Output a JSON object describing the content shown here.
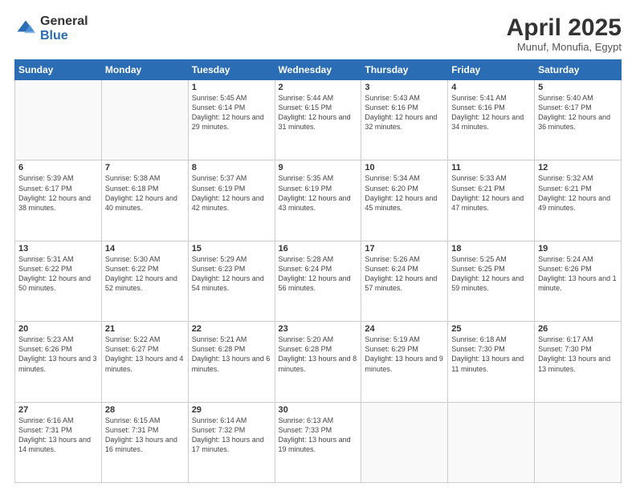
{
  "logo": {
    "general": "General",
    "blue": "Blue"
  },
  "header": {
    "title": "April 2025",
    "subtitle": "Munuf, Monufia, Egypt"
  },
  "weekdays": [
    "Sunday",
    "Monday",
    "Tuesday",
    "Wednesday",
    "Thursday",
    "Friday",
    "Saturday"
  ],
  "weeks": [
    [
      {
        "day": "",
        "info": ""
      },
      {
        "day": "",
        "info": ""
      },
      {
        "day": "1",
        "info": "Sunrise: 5:45 AM\nSunset: 6:14 PM\nDaylight: 12 hours and 29 minutes."
      },
      {
        "day": "2",
        "info": "Sunrise: 5:44 AM\nSunset: 6:15 PM\nDaylight: 12 hours and 31 minutes."
      },
      {
        "day": "3",
        "info": "Sunrise: 5:43 AM\nSunset: 6:16 PM\nDaylight: 12 hours and 32 minutes."
      },
      {
        "day": "4",
        "info": "Sunrise: 5:41 AM\nSunset: 6:16 PM\nDaylight: 12 hours and 34 minutes."
      },
      {
        "day": "5",
        "info": "Sunrise: 5:40 AM\nSunset: 6:17 PM\nDaylight: 12 hours and 36 minutes."
      }
    ],
    [
      {
        "day": "6",
        "info": "Sunrise: 5:39 AM\nSunset: 6:17 PM\nDaylight: 12 hours and 38 minutes."
      },
      {
        "day": "7",
        "info": "Sunrise: 5:38 AM\nSunset: 6:18 PM\nDaylight: 12 hours and 40 minutes."
      },
      {
        "day": "8",
        "info": "Sunrise: 5:37 AM\nSunset: 6:19 PM\nDaylight: 12 hours and 42 minutes."
      },
      {
        "day": "9",
        "info": "Sunrise: 5:35 AM\nSunset: 6:19 PM\nDaylight: 12 hours and 43 minutes."
      },
      {
        "day": "10",
        "info": "Sunrise: 5:34 AM\nSunset: 6:20 PM\nDaylight: 12 hours and 45 minutes."
      },
      {
        "day": "11",
        "info": "Sunrise: 5:33 AM\nSunset: 6:21 PM\nDaylight: 12 hours and 47 minutes."
      },
      {
        "day": "12",
        "info": "Sunrise: 5:32 AM\nSunset: 6:21 PM\nDaylight: 12 hours and 49 minutes."
      }
    ],
    [
      {
        "day": "13",
        "info": "Sunrise: 5:31 AM\nSunset: 6:22 PM\nDaylight: 12 hours and 50 minutes."
      },
      {
        "day": "14",
        "info": "Sunrise: 5:30 AM\nSunset: 6:22 PM\nDaylight: 12 hours and 52 minutes."
      },
      {
        "day": "15",
        "info": "Sunrise: 5:29 AM\nSunset: 6:23 PM\nDaylight: 12 hours and 54 minutes."
      },
      {
        "day": "16",
        "info": "Sunrise: 5:28 AM\nSunset: 6:24 PM\nDaylight: 12 hours and 56 minutes."
      },
      {
        "day": "17",
        "info": "Sunrise: 5:26 AM\nSunset: 6:24 PM\nDaylight: 12 hours and 57 minutes."
      },
      {
        "day": "18",
        "info": "Sunrise: 5:25 AM\nSunset: 6:25 PM\nDaylight: 12 hours and 59 minutes."
      },
      {
        "day": "19",
        "info": "Sunrise: 5:24 AM\nSunset: 6:26 PM\nDaylight: 13 hours and 1 minute."
      }
    ],
    [
      {
        "day": "20",
        "info": "Sunrise: 5:23 AM\nSunset: 6:26 PM\nDaylight: 13 hours and 3 minutes."
      },
      {
        "day": "21",
        "info": "Sunrise: 5:22 AM\nSunset: 6:27 PM\nDaylight: 13 hours and 4 minutes."
      },
      {
        "day": "22",
        "info": "Sunrise: 5:21 AM\nSunset: 6:28 PM\nDaylight: 13 hours and 6 minutes."
      },
      {
        "day": "23",
        "info": "Sunrise: 5:20 AM\nSunset: 6:28 PM\nDaylight: 13 hours and 8 minutes."
      },
      {
        "day": "24",
        "info": "Sunrise: 5:19 AM\nSunset: 6:29 PM\nDaylight: 13 hours and 9 minutes."
      },
      {
        "day": "25",
        "info": "Sunrise: 6:18 AM\nSunset: 7:30 PM\nDaylight: 13 hours and 11 minutes."
      },
      {
        "day": "26",
        "info": "Sunrise: 6:17 AM\nSunset: 7:30 PM\nDaylight: 13 hours and 13 minutes."
      }
    ],
    [
      {
        "day": "27",
        "info": "Sunrise: 6:16 AM\nSunset: 7:31 PM\nDaylight: 13 hours and 14 minutes."
      },
      {
        "day": "28",
        "info": "Sunrise: 6:15 AM\nSunset: 7:31 PM\nDaylight: 13 hours and 16 minutes."
      },
      {
        "day": "29",
        "info": "Sunrise: 6:14 AM\nSunset: 7:32 PM\nDaylight: 13 hours and 17 minutes."
      },
      {
        "day": "30",
        "info": "Sunrise: 6:13 AM\nSunset: 7:33 PM\nDaylight: 13 hours and 19 minutes."
      },
      {
        "day": "",
        "info": ""
      },
      {
        "day": "",
        "info": ""
      },
      {
        "day": "",
        "info": ""
      }
    ]
  ]
}
